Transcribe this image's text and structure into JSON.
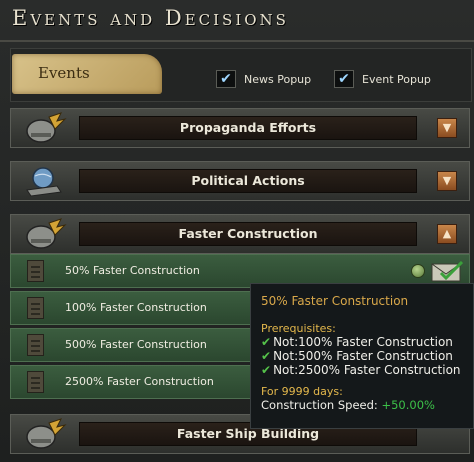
{
  "window": {
    "title": "Events and Decisions"
  },
  "events_panel": {
    "tab_label": "Events",
    "news_popup": {
      "label": "News Popup",
      "checked": true
    },
    "event_popup": {
      "label": "Event Popup",
      "checked": true
    }
  },
  "categories": [
    {
      "label": "Propaganda Efforts",
      "icon": "bird-helmet-icon",
      "expanded": false,
      "toggle": "chevron-down-icon"
    },
    {
      "label": "Political Actions",
      "icon": "globe-tank-icon",
      "expanded": false,
      "toggle": "chevron-down-icon"
    },
    {
      "label": "Faster Construction",
      "icon": "bird-helmet-icon",
      "expanded": true,
      "toggle": "chevron-up-icon"
    },
    {
      "label": "Faster Ship Building",
      "icon": "bird-helmet-icon",
      "expanded": false
    }
  ],
  "decisions": [
    {
      "label": "50% Faster Construction",
      "available": true
    },
    {
      "label": "100% Faster Construction"
    },
    {
      "label": "500% Faster Construction"
    },
    {
      "label": "2500% Faster Construction"
    }
  ],
  "tooltip": {
    "title": "50% Faster Construction",
    "prereq_heading": "Prerequisites:",
    "requirements": [
      "Not:100% Faster Construction",
      "Not:500% Faster Construction",
      "Not:2500% Faster Construction"
    ],
    "duration": "For 9999 days:",
    "effect_label": "Construction Speed:",
    "effect_value": "+50.00%"
  },
  "colors": {
    "accent": "#d9a84a",
    "positive": "#3cc048"
  }
}
